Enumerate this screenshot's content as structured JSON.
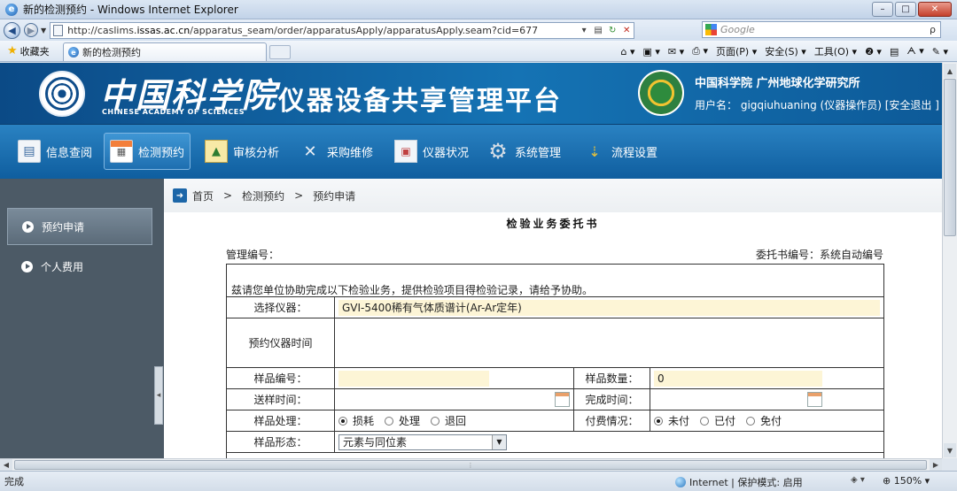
{
  "window": {
    "title": "新的检测预约 - Windows Internet Explorer",
    "controls": {
      "minimize": "–",
      "maximize": "□",
      "close": "✕"
    }
  },
  "address": {
    "url_prefix": "http://caslims.",
    "url_domain": "issas.ac.cn",
    "url_rest": "/apparatus_seam/order/apparatusApply/apparatusApply.seam?cid=677",
    "search_placeholder": "Google",
    "search_go": "ρ"
  },
  "command_bar": {
    "favorites_label": "收藏夹",
    "tab_title": "新的检测预约",
    "tools": [
      "页面(P) ▾",
      "安全(S) ▾",
      "工具(O) ▾",
      "❷ ▾"
    ]
  },
  "header": {
    "cas_cn": "中国科学院",
    "cas_en": "CHINESE ACADEMY OF SCIENCES",
    "platform_title": "仪器设备共享管理平台",
    "institute": "中国科学院 广州地球化学研究所",
    "user_prefix": "用户名：",
    "user_name": "gigqiuhuaning",
    "user_role": "(仪器操作员)",
    "logout_label": "[安全退出 ]"
  },
  "nav": {
    "items": [
      {
        "label": "信息查阅",
        "icon": "document-icon"
      },
      {
        "label": "检测预约",
        "icon": "calendar-icon",
        "active": true
      },
      {
        "label": "审核分析",
        "icon": "chart-icon"
      },
      {
        "label": "采购维修",
        "icon": "tools-icon"
      },
      {
        "label": "仪器状况",
        "icon": "box-icon"
      },
      {
        "label": "系统管理",
        "icon": "gear-icon"
      },
      {
        "label": "流程设置",
        "icon": "flow-icon"
      }
    ]
  },
  "sidebar": {
    "items": [
      {
        "label": "预约申请",
        "active": true
      },
      {
        "label": "个人费用",
        "active": false
      }
    ],
    "collapse_glyph": "◂"
  },
  "breadcrumb": {
    "items": [
      "首页",
      "检测预约",
      "预约申请"
    ],
    "separator": ">"
  },
  "document": {
    "title": "检验业务委托书",
    "mgmt_no_label": "管理编号：",
    "order_no_label": "委托书编号：系统自动编号",
    "intro": "兹请您单位协助完成以下检验业务，提供检验项目得检验记录，请给予协助。"
  },
  "form": {
    "instrument_label": "选择仪器：",
    "instrument_value": "GVI-5400稀有气体质谱计(Ar-Ar定年)",
    "time_label": "预约仪器时间",
    "sample_no_label": "样品编号：",
    "sample_qty_label": "样品数量：",
    "sample_qty_value": "0",
    "send_time_label": "送样时间：",
    "finish_time_label": "完成时间：",
    "treatment_label": "样品处理：",
    "treatment_options": [
      "损耗",
      "处理",
      "退回"
    ],
    "treatment_selected": 0,
    "payment_label": "付费情况：",
    "payment_options": [
      "未付",
      "已付",
      "免付"
    ],
    "payment_selected": 0,
    "form_label": "样品形态：",
    "form_value": "元素与同位素"
  },
  "status": {
    "left": "完成",
    "zone": "Internet | 保护模式: 启用",
    "zoom": "150%"
  }
}
